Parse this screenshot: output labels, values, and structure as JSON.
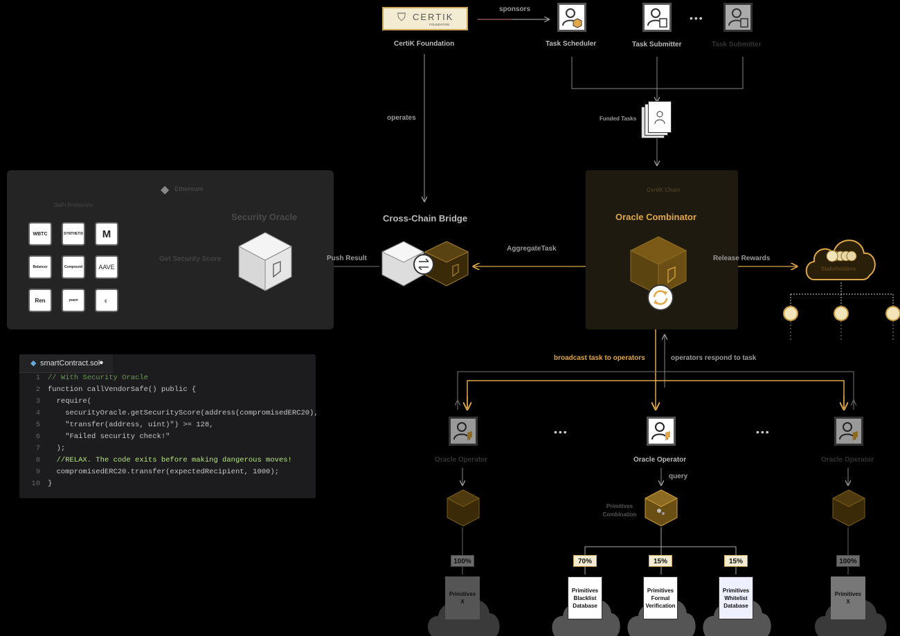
{
  "top": {
    "certik_logo": "CERTIK",
    "certik_logo_sub": "FOUNDATION",
    "certik_foundation": "CertiK Foundation",
    "sponsors": "sponsors",
    "task_scheduler": "Task Scheduler",
    "task_submitter": "Task Submitter",
    "task_submitter_faded": "Task Submitter",
    "operates": "operates",
    "funded_tasks": "Funded Tasks"
  },
  "left_panel": {
    "network": "Ethereum",
    "subtitle": "DeFi Protocols",
    "security_oracle": "Security Oracle",
    "get_security_score": "Get Security Score",
    "logos": [
      "WBTC",
      "SYNTHETIX",
      "M",
      "Balancer",
      "Compound",
      "AAVE",
      "Ren",
      "yearn",
      ""
    ]
  },
  "center": {
    "bridge": "Cross-Chain Bridge",
    "push_result": "Push Result",
    "aggregate_task": "AggregateTask",
    "chain": "CertiK Chain",
    "combinator": "Oracle Combinator",
    "release_rewards": "Release Rewards",
    "stakeholders": "Stakeholders"
  },
  "flow": {
    "broadcast": "broadcast task to operators",
    "respond": "operators respond to task",
    "operator_left": "Oracle Operator",
    "operator_mid": "Oracle Operator",
    "operator_right": "Oracle Operator",
    "query": "query",
    "primitives_combination": "Primitives Combination"
  },
  "primitives": {
    "left_pct": "100%",
    "left_doc": "Primitives X",
    "blacklist_pct": "70%",
    "blacklist_doc": "Primitives Blacklist Database",
    "formal_pct": "15%",
    "formal_doc": "Primitives Formal Verification",
    "whitelist_pct": "15%",
    "whitelist_doc": "Primitives Whitelist Database",
    "right_pct": "100%",
    "right_doc": "Primitives X"
  },
  "code": {
    "filename": "smartContract.sol",
    "lines": [
      {
        "n": "1",
        "t": "// With Security Oracle"
      },
      {
        "n": "2",
        "t": "function callVendorSafe() public {"
      },
      {
        "n": "3",
        "t": "  require("
      },
      {
        "n": "4",
        "t": "    securityOracle.getSecurityScore(address(compromisedERC20),"
      },
      {
        "n": "5",
        "t": "    \"transfer(address, uint)\") >= 128,"
      },
      {
        "n": "6",
        "t": "    \"Failed security check!\""
      },
      {
        "n": "7",
        "t": "  );"
      },
      {
        "n": "8",
        "t": "  //RELAX. The code exits before making dangerous moves!"
      },
      {
        "n": "9",
        "t": "  compromisedERC20.transfer(expectedRecipient, 1000);"
      },
      {
        "n": "10",
        "t": "}"
      }
    ]
  },
  "colors": {
    "gold": "#e0a848",
    "gold_dark": "#6b4e12",
    "panel": "#242424",
    "bg": "#000000"
  }
}
